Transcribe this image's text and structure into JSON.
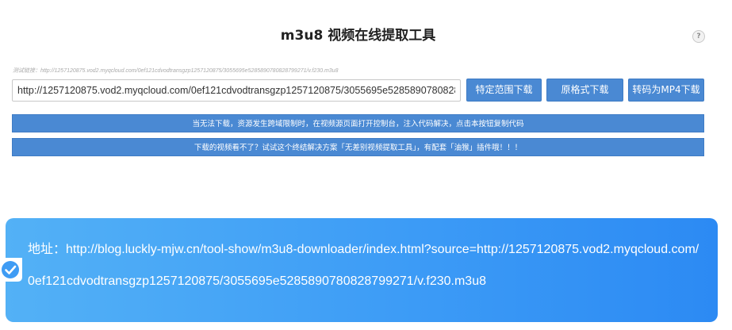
{
  "page": {
    "title": "m3u8 视频在线提取工具",
    "help_label": "?"
  },
  "form": {
    "test_link": "测试链接：http://1257120875.vod2.myqcloud.com/0ef121cdvodtransgzp1257120875/3055695e5285890780828799271/v.f230.m3u8",
    "url_value": "http://1257120875.vod2.myqcloud.com/0ef121cdvodtransgzp1257120875/3055695e5285890780828799271/v.f230.m3u8",
    "buttons": {
      "range_download": "特定范围下载",
      "original_download": "原格式下载",
      "mp4_download": "转码为MP4下载"
    }
  },
  "notices": {
    "cors_tip": "当无法下载，资源发生跨域限制时，在视频源页面打开控制台，注入代码解决，点击本按钮复制代码",
    "ultimate_tip": "下载的视频看不了？试试这个终结解决方案「无差别视频提取工具」，有配套「油猴」插件哦！！！"
  },
  "toast": {
    "text": "地址：http://blog.luckly-mjw.cn/tool-show/m3u8-downloader/index.html?source=http://1257120875.vod2.myqcloud.com/0ef121cdvodtransgzp1257120875/3055695e5285890780828799271/v.f230.m3u8",
    "icon": "check-circle-icon"
  },
  "colors": {
    "button_blue": "#4a89d3",
    "toast_start": "#53b1f6",
    "toast_end": "#2c8af3"
  }
}
